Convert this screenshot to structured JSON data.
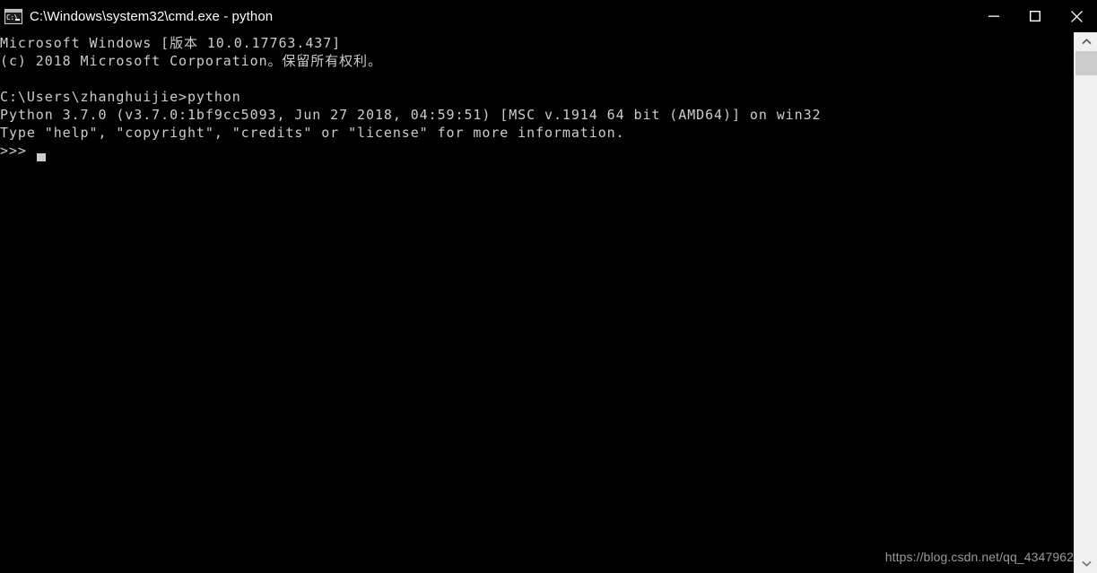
{
  "window": {
    "title": "C:\\Windows\\system32\\cmd.exe - python",
    "icon": "cmd-console-icon",
    "icon_prompt_text": "C:\\",
    "controls": {
      "minimize_label": "Minimize",
      "maximize_label": "Maximize",
      "close_label": "Close"
    },
    "colors": {
      "titlebar_background": "#000000",
      "console_background": "#000000",
      "console_foreground": "#cccccc",
      "title_foreground": "#ffffff",
      "scrollbar_track": "#f0f0f0",
      "scrollbar_thumb": "#cdcdcd",
      "watermark_foreground": "#9a9a9a"
    }
  },
  "console": {
    "lines": [
      "Microsoft Windows [版本 10.0.17763.437]",
      "(c) 2018 Microsoft Corporation。保留所有权利。",
      "",
      "C:\\Users\\zhanghuijie>python",
      "Python 3.7.0 (v3.7.0:1bf9cc5093, Jun 27 2018, 04:59:51) [MSC v.1914 64 bit (AMD64)] on win32",
      "Type \"help\", \"copyright\", \"credits\" or \"license\" for more information.",
      ">>>"
    ],
    "text": "Microsoft Windows [版本 10.0.17763.437]\n(c) 2018 Microsoft Corporation。保留所有权利。\n\nC:\\Users\\zhanghuijie>python\nPython 3.7.0 (v3.7.0:1bf9cc5093, Jun 27 2018, 04:59:51) [MSC v.1914 64 bit (AMD64)] on win32\nType \"help\", \"copyright\", \"credits\" or \"license\" for more information.\n>>>",
    "prompt": ">>>",
    "cursor": "block"
  },
  "scrollbar": {
    "up_arrow": "chevron-up-icon",
    "down_arrow": "chevron-down-icon",
    "thumb_position_percent": 0
  },
  "watermark": {
    "text": "https://blog.csdn.net/qq_4347962"
  }
}
